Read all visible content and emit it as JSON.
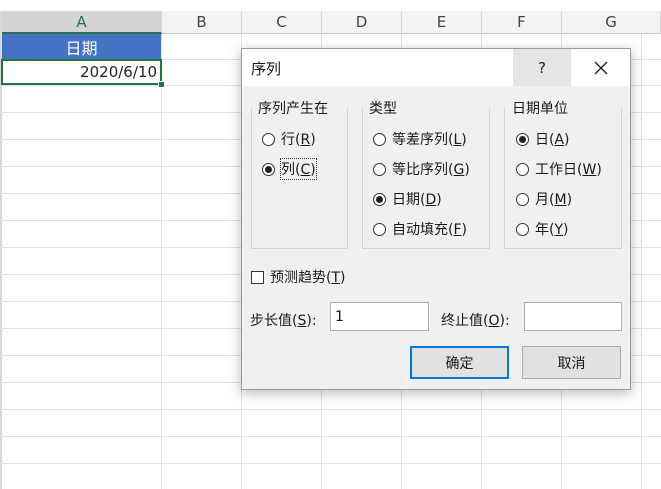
{
  "spreadsheet": {
    "columns": [
      "A",
      "B",
      "C",
      "D",
      "E",
      "F",
      "G"
    ],
    "header_cell": "日期",
    "date_cell": "2020/6/10"
  },
  "dialog": {
    "title": "序列",
    "help_label": "?",
    "series_in": {
      "title": "序列产生在",
      "options": [
        {
          "text": "行(",
          "key": "R",
          "close": ")"
        },
        {
          "text": "列(",
          "key": "C",
          "close": ")"
        }
      ]
    },
    "type": {
      "title": "类型",
      "options": [
        {
          "text": "等差序列(",
          "key": "L",
          "close": ")"
        },
        {
          "text": "等比序列(",
          "key": "G",
          "close": ")"
        },
        {
          "text": "日期(",
          "key": "D",
          "close": ")"
        },
        {
          "text": "自动填充(",
          "key": "F",
          "close": ")"
        }
      ]
    },
    "date_unit": {
      "title": "日期单位",
      "options": [
        {
          "text": "日(",
          "key": "A",
          "close": ")"
        },
        {
          "text": "工作日(",
          "key": "W",
          "close": ")"
        },
        {
          "text": "月(",
          "key": "M",
          "close": ")"
        },
        {
          "text": "年(",
          "key": "Y",
          "close": ")"
        }
      ]
    },
    "trend": {
      "text": "预测趋势(",
      "key": "T",
      "close": ")"
    },
    "step": {
      "text": "步长值(",
      "key": "S",
      "close": "):",
      "value": "1"
    },
    "stop": {
      "text": "终止值(",
      "key": "O",
      "close": "):",
      "value": ""
    },
    "ok_label": "确定",
    "cancel_label": "取消"
  },
  "colors": {
    "accent_green": "#217346",
    "header_fill": "#4472c4",
    "default_button_border": "#0078d7"
  }
}
